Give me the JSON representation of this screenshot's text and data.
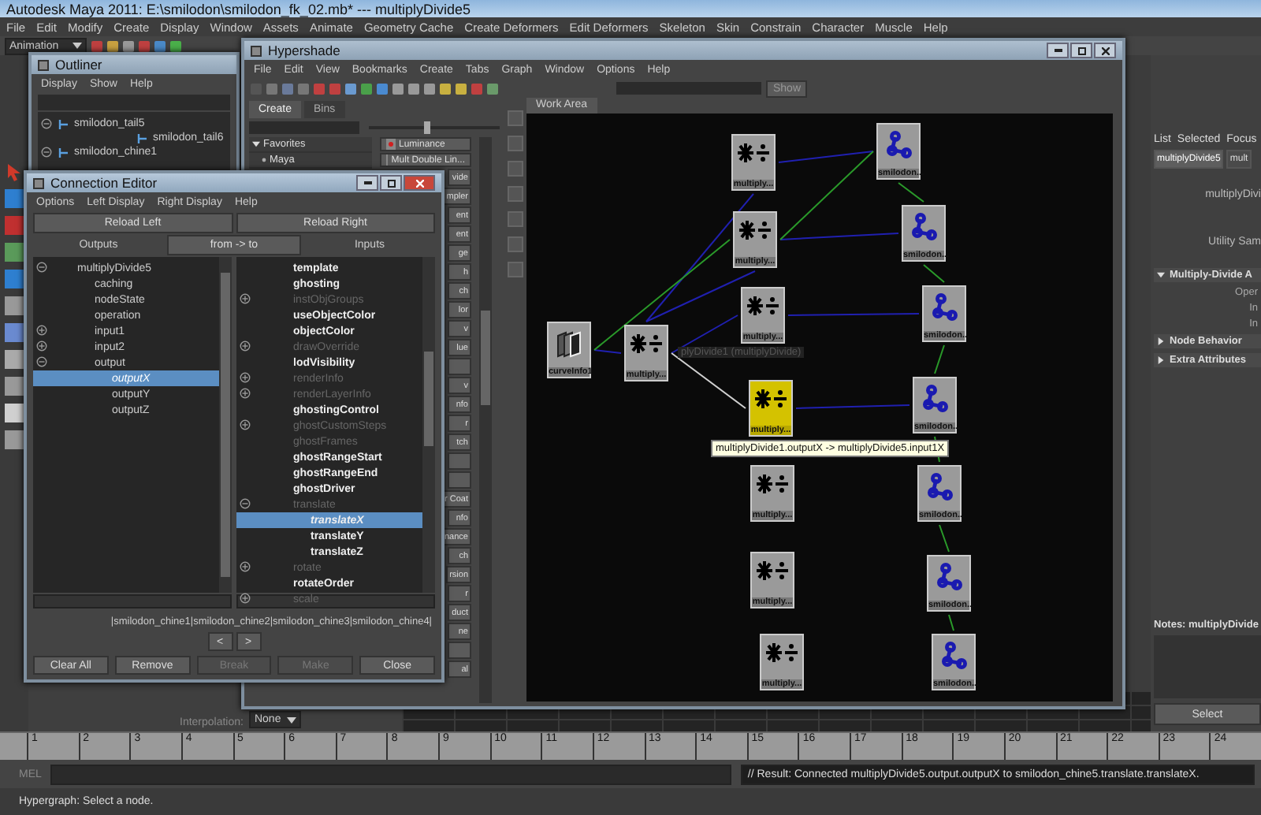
{
  "window": {
    "title": "Autodesk Maya 2011: E:\\smilodon\\smilodon_fk_02.mb*   ---   multiplyDivide5"
  },
  "menu_bar": [
    "File",
    "Edit",
    "Modify",
    "Create",
    "Display",
    "Window",
    "Assets",
    "Animate",
    "Geometry Cache",
    "Create Deformers",
    "Edit Deformers",
    "Skeleton",
    "Skin",
    "Constrain",
    "Character",
    "Muscle",
    "Help"
  ],
  "mode_selector": {
    "value": "Animation"
  },
  "outliner": {
    "title": "Outliner",
    "menu": [
      "Display",
      "Show",
      "Help"
    ],
    "items": [
      {
        "label": "smilodon_tail5",
        "expanded": true,
        "children": [
          {
            "label": "smilodon_tail6"
          }
        ]
      },
      {
        "label": "smilodon_chine1",
        "expanded": true
      }
    ]
  },
  "hypershade": {
    "title": "Hypershade",
    "menu": [
      "File",
      "Edit",
      "View",
      "Bookmarks",
      "Create",
      "Tabs",
      "Graph",
      "Window",
      "Options",
      "Help"
    ],
    "show_button": "Show",
    "tabs": [
      {
        "label": "Create",
        "selected": true
      },
      {
        "label": "Bins",
        "selected": false
      }
    ],
    "size_slider": {
      "level": 0.45
    },
    "favorites": [
      {
        "label": "Favorites",
        "expanded": true,
        "children": [
          {
            "label": "Maya"
          }
        ]
      }
    ],
    "node_types": [
      {
        "kind": "full",
        "label": "Luminance"
      },
      {
        "kind": "full",
        "label": "Mult Double Lin..."
      },
      {
        "kind": "clipped",
        "label": "vide"
      },
      {
        "kind": "clipped",
        "label": "mpler"
      },
      {
        "kind": "clipped",
        "label": "ent"
      },
      {
        "kind": "clipped",
        "label": "ent"
      },
      {
        "kind": "clipped",
        "label": "ge"
      },
      {
        "kind": "clipped",
        "label": "h"
      },
      {
        "kind": "clipped",
        "label": "ch"
      },
      {
        "kind": "clipped",
        "label": "lor"
      },
      {
        "kind": "clipped",
        "label": "v"
      },
      {
        "kind": "clipped",
        "label": "lue"
      },
      {
        "kind": "blank"
      },
      {
        "kind": "clipped",
        "label": "v"
      },
      {
        "kind": "clipped",
        "label": "nfo"
      },
      {
        "kind": "clipped",
        "label": "r"
      },
      {
        "kind": "clipped",
        "label": "tch"
      },
      {
        "kind": "blank"
      },
      {
        "kind": "blank"
      },
      {
        "kind": "clipped",
        "label": "r Coat"
      },
      {
        "kind": "clipped",
        "label": "nfo"
      },
      {
        "kind": "clipped",
        "label": "nance"
      },
      {
        "kind": "clipped",
        "label": "ch"
      },
      {
        "kind": "clipped",
        "label": "rsion"
      },
      {
        "kind": "clipped",
        "label": "r"
      },
      {
        "kind": "clipped",
        "label": "duct"
      },
      {
        "kind": "clipped",
        "label": "ne"
      },
      {
        "kind": "blank"
      },
      {
        "kind": "clipped",
        "label": "al"
      }
    ],
    "work_area_tab": "Work Area",
    "nodes": [
      {
        "kind": "multiply",
        "label": "multiply...",
        "selected": false
      },
      {
        "kind": "multiply",
        "label": "multiply...",
        "selected": false
      },
      {
        "kind": "multiply",
        "label": "multiply...",
        "selected": false
      },
      {
        "kind": "multiply",
        "label": "multiply...",
        "selected": true
      },
      {
        "kind": "multiply",
        "label": "multiply...",
        "selected": false
      },
      {
        "kind": "multiply",
        "label": "multiply...",
        "selected": false
      },
      {
        "kind": "multiply",
        "label": "multiply...",
        "selected": false
      },
      {
        "kind": "multiply",
        "label": "multiply...",
        "selected": false
      },
      {
        "kind": "joint",
        "label": "smilodon...",
        "selected": false
      },
      {
        "kind": "joint",
        "label": "smilodon...",
        "selected": false
      },
      {
        "kind": "joint",
        "label": "smilodon...",
        "selected": false
      },
      {
        "kind": "joint",
        "label": "smilodon...",
        "selected": false
      },
      {
        "kind": "joint",
        "label": "smilodon...",
        "selected": false
      },
      {
        "kind": "joint",
        "label": "smilodon...",
        "selected": false
      },
      {
        "kind": "joint",
        "label": "smilodon...",
        "selected": false
      },
      {
        "kind": "curve_info",
        "label": "curveInfo1",
        "selected": false
      }
    ],
    "connections": [
      {
        "color": "#2020b0"
      },
      {
        "color": "#2020b0"
      },
      {
        "color": "#2020b0"
      },
      {
        "color": "#2020b0"
      },
      {
        "color": "#2020b0"
      },
      {
        "color": "#2020b0"
      },
      {
        "color": "#2020b0"
      },
      {
        "color": "#2020b0"
      },
      {
        "color": "#2a9a2a"
      },
      {
        "color": "#2a9a2a"
      },
      {
        "color": "#2a9a2a"
      },
      {
        "color": "#2a9a2a"
      },
      {
        "color": "#2a9a2a"
      },
      {
        "color": "#2a9a2a"
      },
      {
        "color": "#2a9a2a"
      },
      {
        "color": "#2a9a2a"
      },
      {
        "color": "#d0d0d0"
      }
    ],
    "hover_label": "plyDivide1 (multiplyDivide)",
    "tooltip": "multiplyDivide1.outputX -> multiplyDivide5.input1X"
  },
  "connection_editor": {
    "title": "Connection Editor",
    "menu": [
      "Options",
      "Left Display",
      "Right Display",
      "Help"
    ],
    "reload_buttons": [
      "Reload Left",
      "Reload Right"
    ],
    "headers": {
      "left": "Outputs",
      "mode": "from -> to",
      "right": "Inputs"
    },
    "outputs": [
      {
        "label": "multiplyDivide5",
        "selected": false,
        "expanded": true,
        "children": [
          {
            "label": "caching",
            "selected": false
          },
          {
            "label": "nodeState",
            "selected": false
          },
          {
            "label": "operation",
            "selected": false
          },
          {
            "label": "input1",
            "selected": false,
            "expanded": false
          },
          {
            "label": "input2",
            "selected": false,
            "expanded": false
          },
          {
            "label": "output",
            "selected": false,
            "expanded": true,
            "children": [
              {
                "label": "outputX",
                "selected": true
              },
              {
                "label": "outputY",
                "selected": false
              },
              {
                "label": "outputZ",
                "selected": false
              }
            ]
          }
        ]
      }
    ],
    "inputs": [
      {
        "label": "template",
        "selected": false,
        "disabled": false
      },
      {
        "label": "ghosting",
        "selected": false,
        "disabled": false
      },
      {
        "label": "instObjGroups",
        "selected": false,
        "disabled": true,
        "expanded": false
      },
      {
        "label": "useObjectColor",
        "selected": false,
        "disabled": false
      },
      {
        "label": "objectColor",
        "selected": false,
        "disabled": false
      },
      {
        "label": "drawOverride",
        "selected": false,
        "disabled": true,
        "expanded": false
      },
      {
        "label": "lodVisibility",
        "selected": false,
        "disabled": false
      },
      {
        "label": "renderInfo",
        "selected": false,
        "disabled": true,
        "expanded": false
      },
      {
        "label": "renderLayerInfo",
        "selected": false,
        "disabled": true,
        "expanded": false
      },
      {
        "label": "ghostingControl",
        "selected": false,
        "disabled": false
      },
      {
        "label": "ghostCustomSteps",
        "selected": false,
        "disabled": true,
        "expanded": false
      },
      {
        "label": "ghostFrames",
        "selected": false,
        "disabled": true
      },
      {
        "label": "ghostRangeStart",
        "selected": false,
        "disabled": false
      },
      {
        "label": "ghostRangeEnd",
        "selected": false,
        "disabled": false
      },
      {
        "label": "ghostDriver",
        "selected": false,
        "disabled": false
      },
      {
        "label": "translate",
        "selected": false,
        "disabled": true,
        "expanded": true,
        "children": [
          {
            "label": "translateX",
            "selected": true,
            "disabled": false
          },
          {
            "label": "translateY",
            "selected": false,
            "disabled": false
          },
          {
            "label": "translateZ",
            "selected": false,
            "disabled": false
          }
        ]
      },
      {
        "label": "rotate",
        "selected": false,
        "disabled": true,
        "expanded": false
      },
      {
        "label": "rotateOrder",
        "selected": false,
        "disabled": false
      },
      {
        "label": "scale",
        "selected": false,
        "disabled": true,
        "expanded": false
      }
    ],
    "path": "|smilodon_chine1|smilodon_chine2|smilodon_chine3|smilodon_chine4|",
    "nav_buttons": [
      "<",
      ">"
    ],
    "buttons": [
      {
        "label": "Clear All",
        "disabled": false
      },
      {
        "label": "Remove",
        "disabled": false
      },
      {
        "label": "Break",
        "disabled": true
      },
      {
        "label": "Make",
        "disabled": true
      },
      {
        "label": "Close",
        "disabled": false
      }
    ]
  },
  "attribute_editor": {
    "menu": [
      "List",
      "Selected",
      "Focus"
    ],
    "tabs": [
      {
        "label": "multiplyDivide5",
        "selected": true
      },
      {
        "label": "mult",
        "selected": false
      }
    ],
    "node_label": "multiplyDivi",
    "type_label": "Utility Sam",
    "sections": [
      {
        "label": "Multiply-Divide A",
        "expanded": true,
        "fields": [
          "Oper",
          "In",
          "In"
        ]
      },
      {
        "label": "Node Behavior",
        "expanded": false
      },
      {
        "label": "Extra Attributes",
        "expanded": false
      }
    ],
    "notes_label": "Notes: multiplyDivide",
    "select_button": "Select"
  },
  "graph_editor": {
    "interpolation_label": "Interpolation:",
    "interpolation_value": "None"
  },
  "timeline": {
    "ticks": [
      "1",
      "2",
      "3",
      "4",
      "5",
      "6",
      "7",
      "8",
      "9",
      "10",
      "11",
      "12",
      "13",
      "14",
      "15",
      "16",
      "17",
      "18",
      "19",
      "20",
      "21",
      "22",
      "23",
      "24"
    ]
  },
  "command_line": {
    "label": "MEL",
    "result": "// Result: Connected multiplyDivide5.output.outputX to smilodon_chine5.translate.translateX."
  },
  "help_line": "Hypergraph: Select a node."
}
